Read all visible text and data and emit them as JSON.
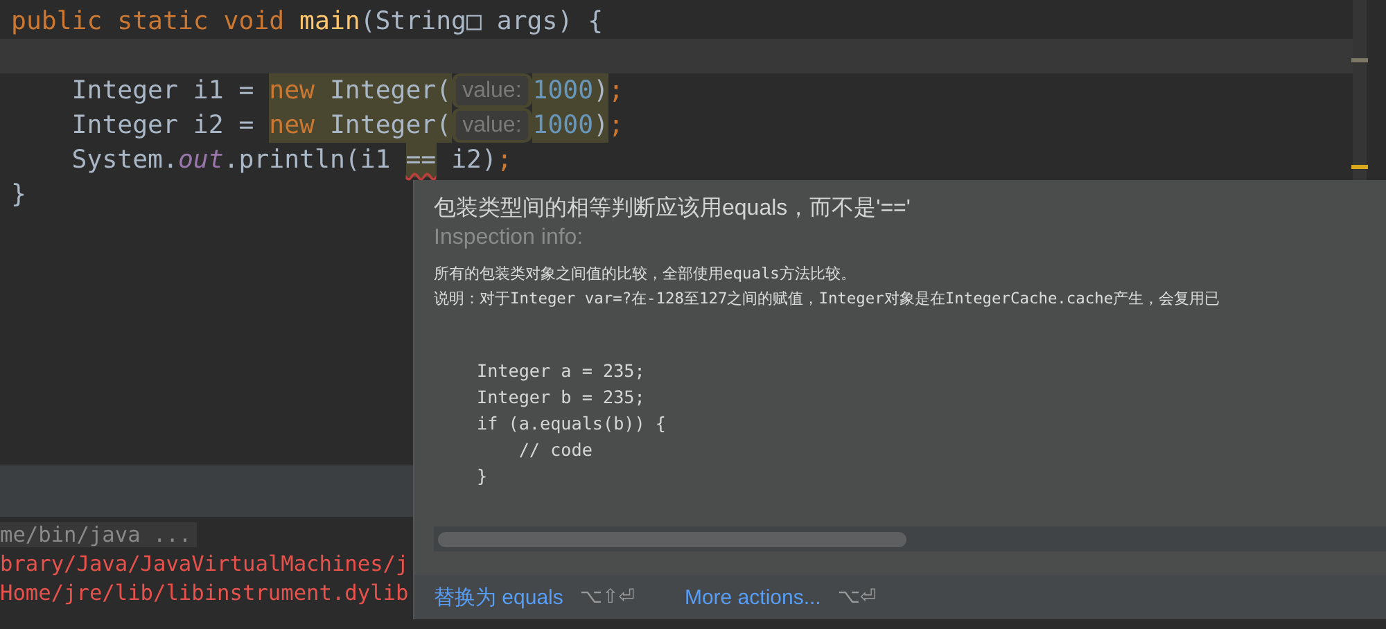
{
  "editor": {
    "lines": [
      {
        "current": false,
        "tokens": [
          {
            "text": "public static void ",
            "kind": "keyword",
            "highlighted": false
          },
          {
            "text": "main",
            "kind": "method",
            "highlighted": false
          },
          {
            "text": "(String□ args) {",
            "kind": "plain",
            "highlighted": false
          }
        ]
      },
      {
        "current": true
      },
      {
        "current": false,
        "tokens": [
          {
            "text": "    Integer i1 = ",
            "kind": "plain",
            "highlighted": false
          },
          {
            "text": "new",
            "kind": "keyword",
            "highlighted": true
          },
          {
            "text": " Integer(",
            "kind": "plain",
            "highlighted": true
          },
          {
            "text": "value:",
            "kind": "hint",
            "highlighted": true
          },
          {
            "text": "1000",
            "kind": "number",
            "highlighted": true
          },
          {
            "text": ")",
            "kind": "plain",
            "highlighted": true
          },
          {
            "text": ";",
            "kind": "keyword",
            "highlighted": false
          }
        ]
      },
      {
        "current": false,
        "tokens": [
          {
            "text": "    Integer i2 = ",
            "kind": "plain",
            "highlighted": false
          },
          {
            "text": "new",
            "kind": "keyword",
            "highlighted": true
          },
          {
            "text": " Integer(",
            "kind": "plain",
            "highlighted": true
          },
          {
            "text": "value:",
            "kind": "hint",
            "highlighted": true
          },
          {
            "text": "1000",
            "kind": "number",
            "highlighted": true
          },
          {
            "text": ")",
            "kind": "plain",
            "highlighted": true
          },
          {
            "text": ";",
            "kind": "keyword",
            "highlighted": false
          }
        ]
      },
      {
        "current": false,
        "tokens": [
          {
            "text": "    System.",
            "kind": "plain",
            "highlighted": false
          },
          {
            "text": "out",
            "kind": "field",
            "highlighted": false
          },
          {
            "text": ".println(i1 ",
            "kind": "plain",
            "highlighted": false
          },
          {
            "text": "==",
            "kind": "warning",
            "highlighted": true
          },
          {
            "text": " i2)",
            "kind": "plain",
            "highlighted": false
          },
          {
            "text": ";",
            "kind": "keyword",
            "highlighted": false
          }
        ]
      },
      {
        "current": false,
        "tokens": [
          {
            "text": "}",
            "kind": "plain",
            "highlighted": false
          }
        ]
      }
    ]
  },
  "console": {
    "lines": [
      {
        "text": "me/bin/java ...",
        "kind": "command"
      },
      {
        "text": "brary/Java/JavaVirtualMachines/j",
        "kind": "error"
      },
      {
        "text": "Home/jre/lib/libinstrument.dylib",
        "kind": "error"
      }
    ]
  },
  "popup": {
    "title": "包装类型间的相等判断应该用equals，而不是'=='",
    "subtitle": "Inspection info:",
    "description": [
      "所有的包装类对象之间值的比较，全部使用equals方法比较。",
      "说明：对于Integer var=?在-128至127之间的赋值，Integer对象是在IntegerCache.cache产生，会复用已"
    ],
    "code": [
      "Integer a = 235;",
      "Integer b = 235;",
      "if (a.equals(b)) {",
      "    // code",
      "}"
    ],
    "actions": [
      {
        "label": "替换为 equals",
        "shortcut": "⌥⇧⏎"
      },
      {
        "label": "More actions...",
        "shortcut": "⌥⏎"
      }
    ]
  }
}
